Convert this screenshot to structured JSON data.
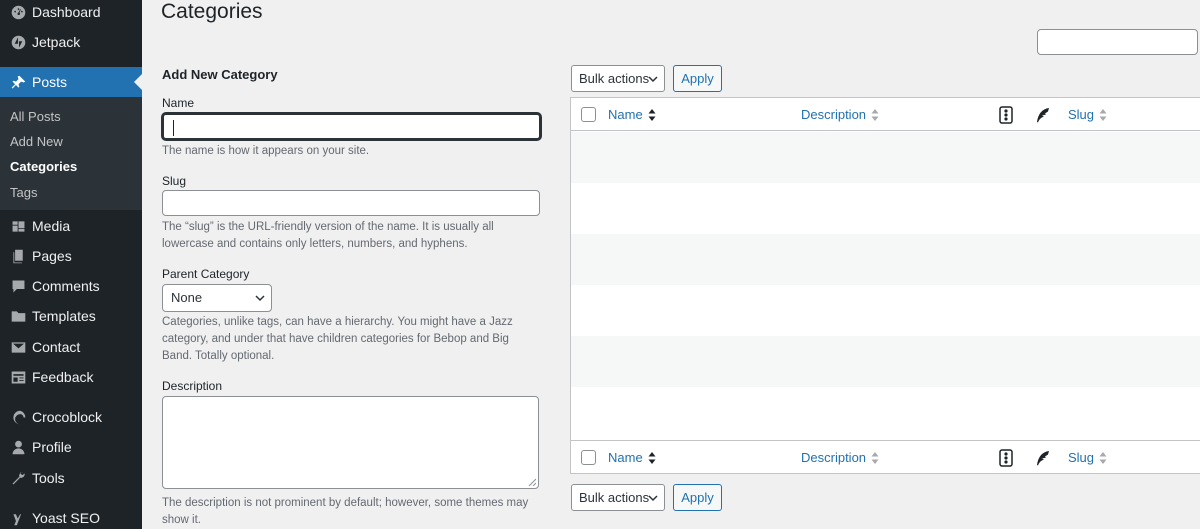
{
  "sidebar": {
    "menu": [
      {
        "label": "Dashboard",
        "icon": "dashboard-icon"
      },
      {
        "label": "Jetpack",
        "icon": "jetpack-icon"
      },
      {
        "label": "Posts",
        "icon": "pushpin-icon"
      },
      {
        "label": "Media",
        "icon": "media-icon"
      },
      {
        "label": "Pages",
        "icon": "pages-icon"
      },
      {
        "label": "Comments",
        "icon": "comments-icon"
      },
      {
        "label": "Templates",
        "icon": "folder-icon"
      },
      {
        "label": "Contact",
        "icon": "envelope-icon"
      },
      {
        "label": "Feedback",
        "icon": "feedback-icon"
      },
      {
        "label": "Crocoblock",
        "icon": "crocoblock-icon"
      },
      {
        "label": "Profile",
        "icon": "user-icon"
      },
      {
        "label": "Tools",
        "icon": "wrench-icon"
      },
      {
        "label": "Yoast SEO",
        "icon": "yoast-icon"
      }
    ],
    "submenu": [
      "All Posts",
      "Add New",
      "Categories",
      "Tags"
    ]
  },
  "page": {
    "title": "Categories"
  },
  "form": {
    "heading": "Add New Category",
    "name_label": "Name",
    "name_value": "",
    "name_help": "The name is how it appears on your site.",
    "slug_label": "Slug",
    "slug_value": "",
    "slug_help": "The “slug” is the URL-friendly version of the name. It is usually all lowercase and contains only letters, numbers, and hyphens.",
    "parent_label": "Parent Category",
    "parent_selected": "None",
    "parent_help": "Categories, unlike tags, can have a hierarchy. You might have a Jazz category, and under that have children categories for Bebop and Big Band. Totally optional.",
    "description_label": "Description",
    "description_value": "",
    "description_help": "The description is not prominent by default; however, some themes may show it."
  },
  "table": {
    "bulk_actions": "Bulk actions",
    "apply": "Apply",
    "columns": {
      "name": "Name",
      "description": "Description",
      "slug": "Slug"
    }
  },
  "colors": {
    "sidebar_bg": "#1d2327",
    "accent": "#2271b1",
    "page_bg": "#f0f0f1"
  }
}
